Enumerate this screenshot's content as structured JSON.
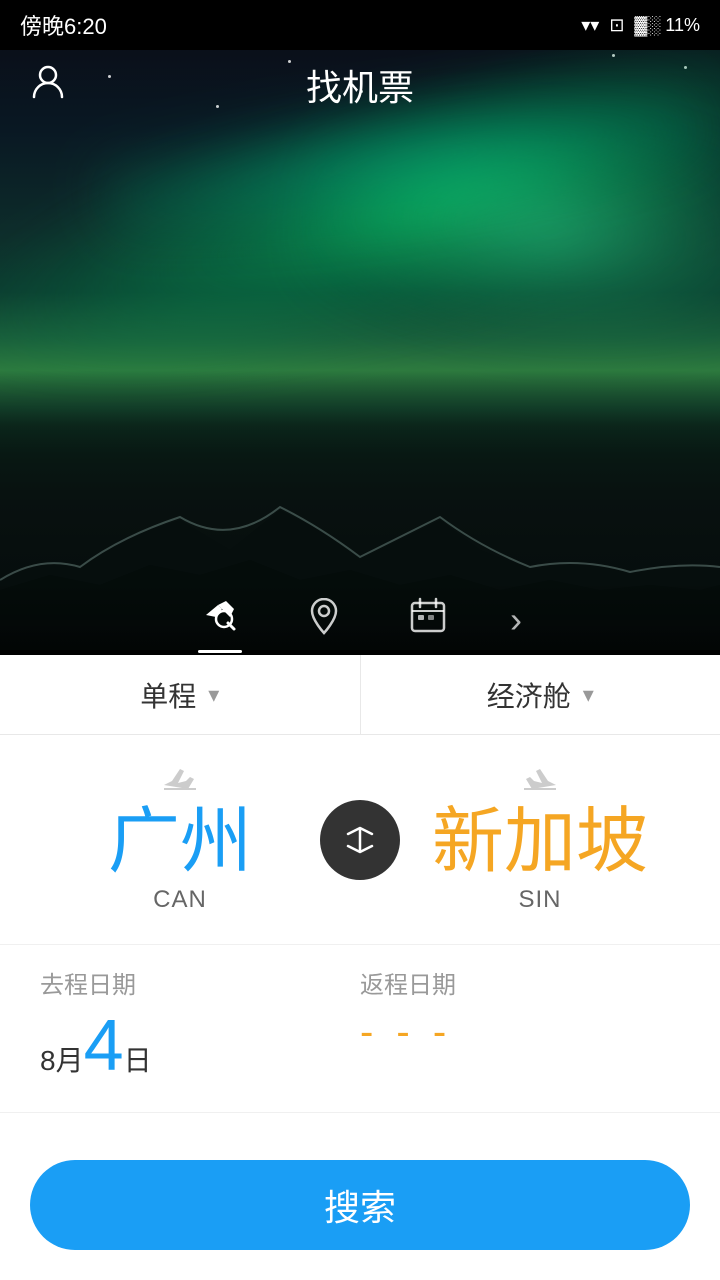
{
  "statusBar": {
    "time": "傍晚6:20",
    "battery": "11%",
    "wifi": "WiFi",
    "batteryIcon": "🔋"
  },
  "header": {
    "title": "找机票",
    "userIcon": "user-icon"
  },
  "iconTabs": [
    {
      "id": "flight-search",
      "icon": "✈",
      "active": true,
      "label": "机票搜索"
    },
    {
      "id": "destination",
      "icon": "📍",
      "active": false,
      "label": "目的地"
    },
    {
      "id": "calendar",
      "icon": "📅",
      "active": false,
      "label": "日历"
    }
  ],
  "selectors": {
    "tripType": {
      "label": "单程",
      "arrow": "▾"
    },
    "cabinClass": {
      "label": "经济舱",
      "arrow": "▾"
    }
  },
  "route": {
    "from": {
      "city": "广州",
      "code": "CAN",
      "direction": "from"
    },
    "to": {
      "city": "新加坡",
      "code": "SIN",
      "direction": "to"
    },
    "swapLabel": "swap"
  },
  "dates": {
    "departure": {
      "label": "去程日期",
      "month": "8月",
      "day": "4",
      "weekday": "日"
    },
    "return": {
      "label": "返程日期",
      "placeholder": "- - -"
    }
  },
  "searchButton": {
    "label": "搜索"
  }
}
